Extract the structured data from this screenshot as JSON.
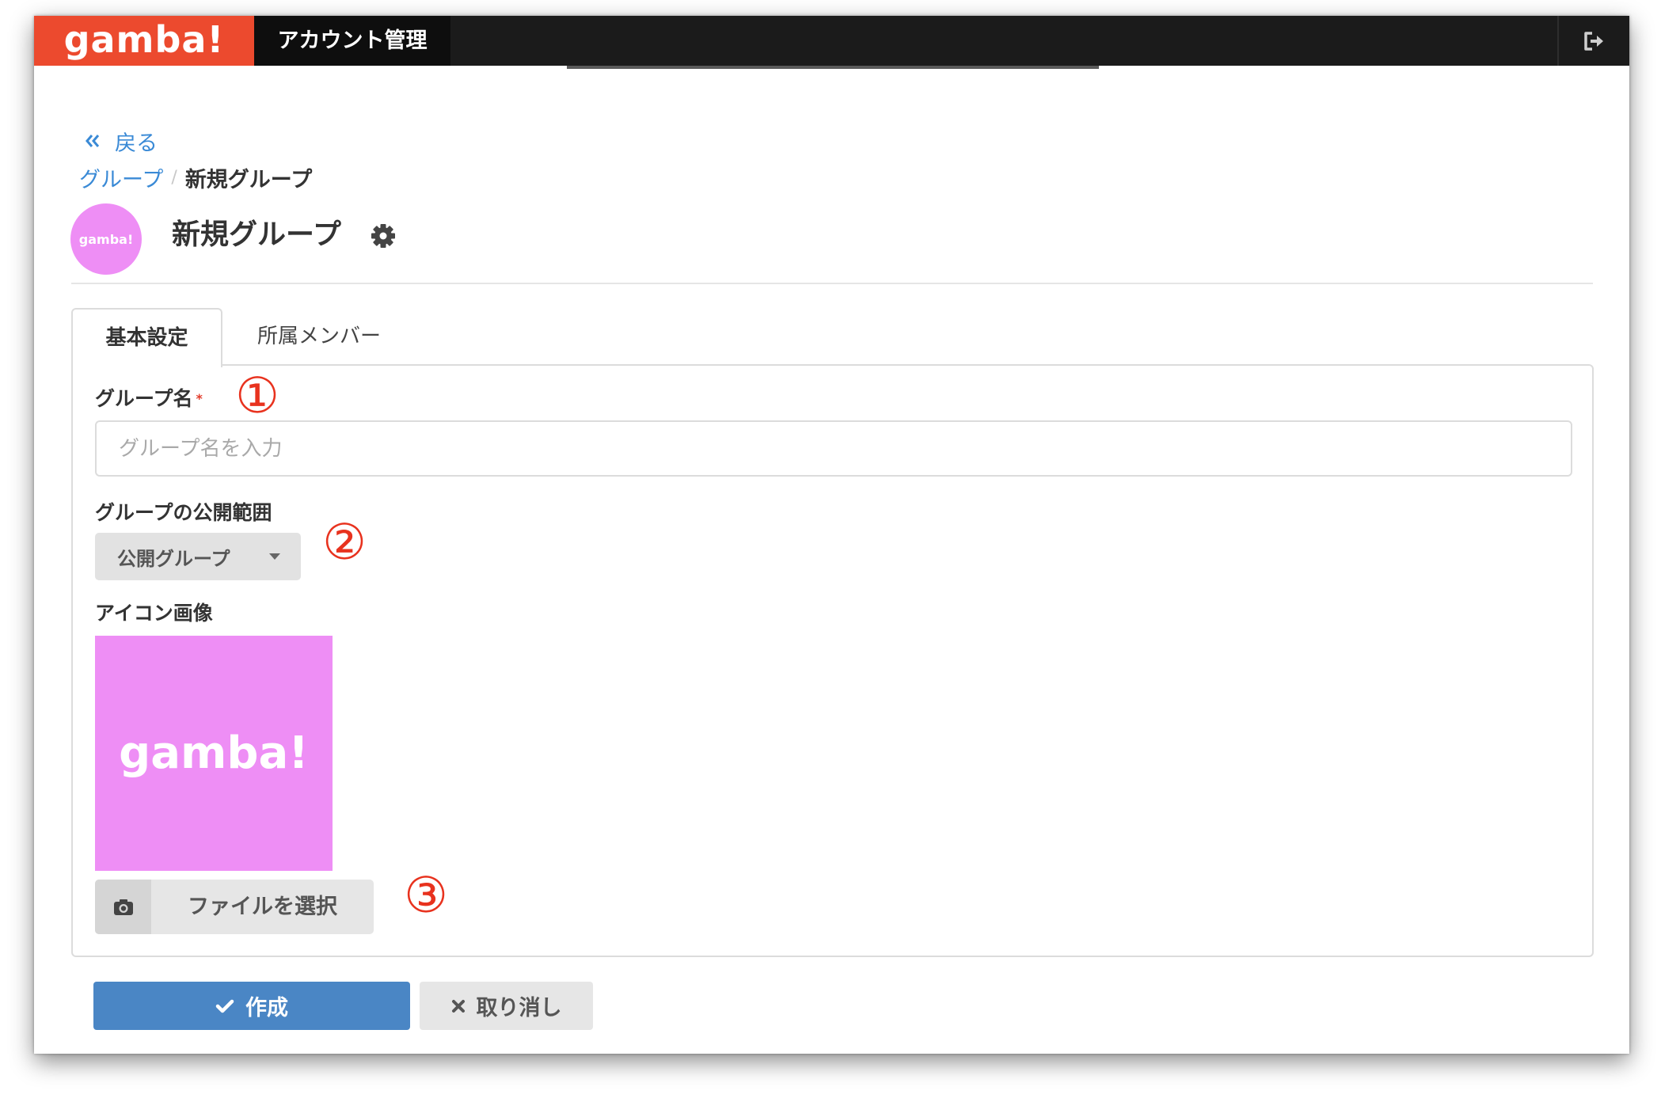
{
  "app": {
    "logo": "gamba!",
    "nav_title": "アカウント管理"
  },
  "nav": {
    "back_label": "戻る"
  },
  "breadcrumb": {
    "items": [
      {
        "label": "グループ"
      },
      {
        "label": "新規グループ"
      }
    ],
    "separator": "/"
  },
  "header": {
    "title": "新規グループ",
    "avatar_text": "gamba!"
  },
  "tabs": [
    {
      "label": "基本設定",
      "active": true
    },
    {
      "label": "所属メンバー",
      "active": false
    }
  ],
  "form": {
    "group_name": {
      "label": "グループ名",
      "required_mark": "*",
      "placeholder": "グループ名を入力"
    },
    "visibility": {
      "label": "グループの公開範囲",
      "selected": "公開グループ"
    },
    "icon_image": {
      "label": "アイコン画像",
      "preview_text": "gamba!",
      "file_button_label": "ファイルを選択"
    }
  },
  "annotations": {
    "step1": "①",
    "step2": "②",
    "step3": "③"
  },
  "actions": {
    "submit_label": "作成",
    "cancel_label": "取り消し"
  },
  "icons": {
    "logout": "sign-out-icon",
    "back": "double-chevron-left-icon",
    "settings": "gear-icon",
    "dropdown": "caret-down-icon",
    "file": "camera-icon",
    "submit": "check-icon",
    "cancel": "close-icon"
  },
  "colors": {
    "brand": "#ec4a2e",
    "nav_bg": "#1b1b1b",
    "link": "#3a8ad6",
    "primary": "#4a86c5",
    "avatar": "#ee8ef5",
    "annotation": "#e8321e"
  }
}
